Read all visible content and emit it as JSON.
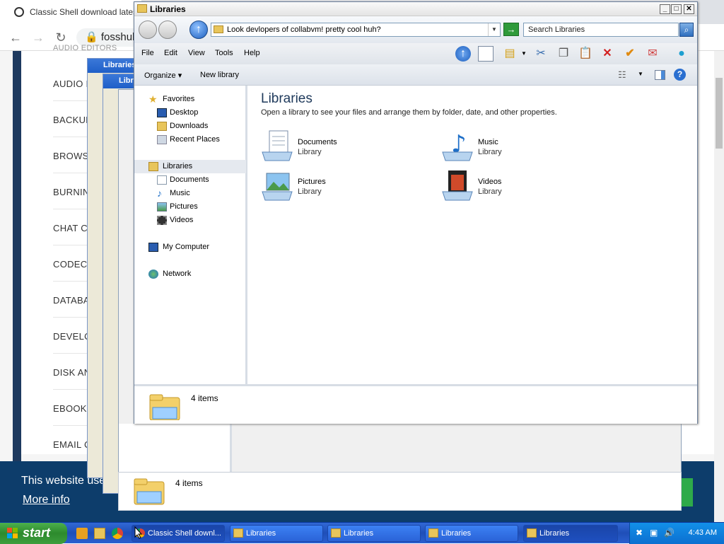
{
  "browser": {
    "tab_title": "Classic Shell download latest",
    "url": "fosshub",
    "categories": [
      "AUDIO EDITORS",
      "AUDIO P",
      "BACKUP",
      "BROWS",
      "BURNIN",
      "CHAT CL",
      "CODEC",
      "DATABA",
      "DEVELO",
      "DISK AN",
      "EBOOK",
      "EMAIL C"
    ]
  },
  "cookie": {
    "text": "This website use",
    "more_info": "More info"
  },
  "stacked_title": "Libraries",
  "window": {
    "title": "Libraries",
    "address": "Look devlopers of collabvm! pretty cool huh?",
    "search_placeholder": "Search Libraries",
    "menu": [
      "File",
      "Edit",
      "View",
      "Tools",
      "Help"
    ],
    "organize": "Organize",
    "new_library": "New library",
    "nav": {
      "favorites": "Favorites",
      "desktop": "Desktop",
      "downloads": "Downloads",
      "recent": "Recent Places",
      "libraries": "Libraries",
      "documents": "Documents",
      "music": "Music",
      "pictures": "Pictures",
      "videos": "Videos",
      "computer": "My Computer",
      "network": "Network"
    },
    "heading": "Libraries",
    "subheading": "Open a library to see your files and arrange them by folder, date, and other properties.",
    "libraries": [
      {
        "name": "Documents",
        "type": "Library"
      },
      {
        "name": "Music",
        "type": "Library"
      },
      {
        "name": "Pictures",
        "type": "Library"
      },
      {
        "name": "Videos",
        "type": "Library"
      }
    ],
    "item_count": "4 items"
  },
  "second_window": {
    "item_count": "4 items"
  },
  "taskbar": {
    "start": "start",
    "tasks": [
      "Classic Shell downl...",
      "Libraries",
      "Libraries",
      "Libraries",
      "Libraries"
    ],
    "clock": "4:43 AM"
  }
}
